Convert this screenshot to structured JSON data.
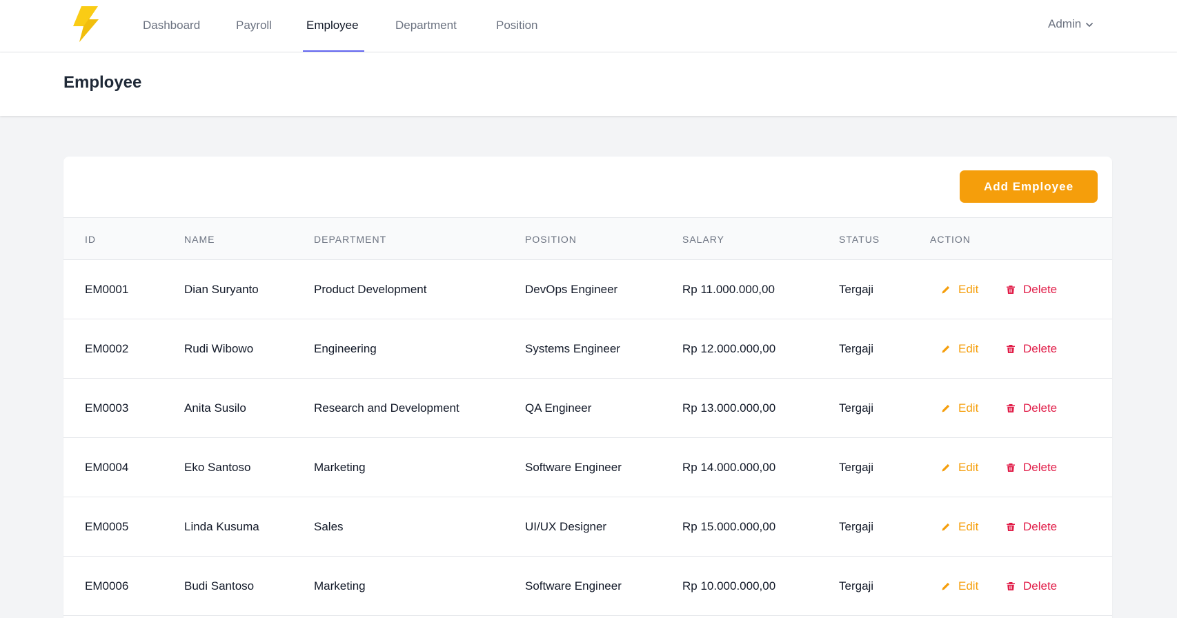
{
  "nav": {
    "logo_icon": "lightning-bolt-icon",
    "links": [
      "Dashboard",
      "Payroll",
      "Employee",
      "Department",
      "Position"
    ],
    "active": "Employee",
    "user_label": "Admin",
    "user_icon": "chevron-down-icon"
  },
  "header": {
    "title": "Employee"
  },
  "toolbar": {
    "add_label": "Add Employee"
  },
  "table": {
    "columns": [
      "ID",
      "NAME",
      "DEPARTMENT",
      "POSITION",
      "SALARY",
      "STATUS",
      "ACTION"
    ],
    "actions": {
      "edit": "Edit",
      "delete": "Delete",
      "edit_icon": "pencil-icon",
      "delete_icon": "trash-icon"
    },
    "rows": [
      {
        "id": "EM0001",
        "name": "Dian Suryanto",
        "department": "Product Development",
        "position": "DevOps Engineer",
        "salary": "Rp 11.000.000,00",
        "status": "Tergaji"
      },
      {
        "id": "EM0002",
        "name": "Rudi Wibowo",
        "department": "Engineering",
        "position": "Systems Engineer",
        "salary": "Rp 12.000.000,00",
        "status": "Tergaji"
      },
      {
        "id": "EM0003",
        "name": "Anita Susilo",
        "department": "Research and Development",
        "position": "QA Engineer",
        "salary": "Rp 13.000.000,00",
        "status": "Tergaji"
      },
      {
        "id": "EM0004",
        "name": "Eko Santoso",
        "department": "Marketing",
        "position": "Software Engineer",
        "salary": "Rp 14.000.000,00",
        "status": "Tergaji"
      },
      {
        "id": "EM0005",
        "name": "Linda Kusuma",
        "department": "Sales",
        "position": "UI/UX Designer",
        "salary": "Rp 15.000.000,00",
        "status": "Tergaji"
      },
      {
        "id": "EM0006",
        "name": "Budi Santoso",
        "department": "Marketing",
        "position": "Software Engineer",
        "salary": "Rp 10.000.000,00",
        "status": "Tergaji"
      }
    ]
  },
  "colors": {
    "accent": "#f59e0b",
    "active_tab": "#6366f1",
    "danger": "#e11d48",
    "logo": "#facc15"
  }
}
